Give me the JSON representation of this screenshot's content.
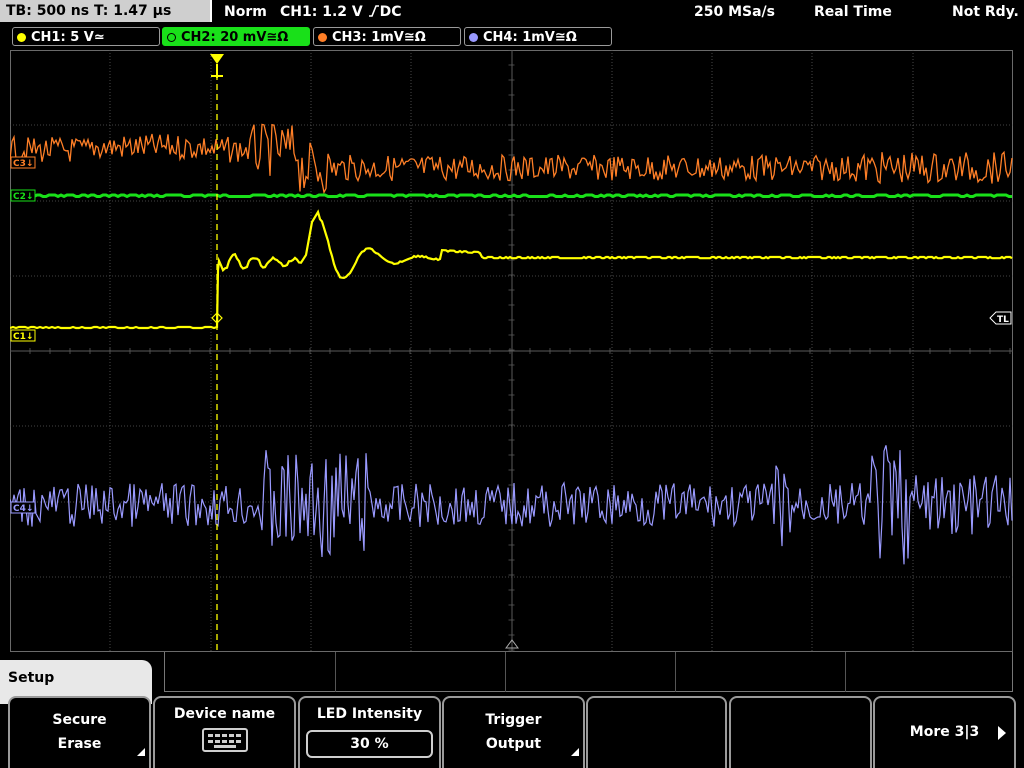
{
  "topbar": {
    "timebase": "TB: 500 ns   T: 1.47 µs",
    "trigger_mode": "Norm",
    "trigger_info": "CH1: 1.2 V",
    "trigger_suffix": "DC",
    "sample_rate": "250 MSa/s",
    "acq_mode": "Real Time",
    "status": "Not Rdy."
  },
  "channels": [
    {
      "label": "CH1: 5 V≃",
      "color": "#ffff00",
      "active": false
    },
    {
      "label": "CH2: 20 mV≅Ω",
      "color": "#19e019",
      "active": true
    },
    {
      "label": "CH3: 1mV≅Ω",
      "color": "#ff7f27",
      "active": false
    },
    {
      "label": "CH4: 1mV≅Ω",
      "color": "#9a9aff",
      "active": false
    }
  ],
  "markers": {
    "ch3": "C3↓",
    "ch2": "C2↓",
    "ch1": "C1↓",
    "ch4": "C4↓",
    "trigger_level": "TL"
  },
  "menu": {
    "title": "Setup",
    "softkeys": [
      {
        "line1": "Secure",
        "line2": "Erase"
      },
      {
        "line1": "Device name",
        "line2": ""
      },
      {
        "line1": "LED Intensity",
        "value": "30 %"
      },
      {
        "line1": "Trigger",
        "line2": "Output"
      },
      {
        "line1": "",
        "line2": ""
      },
      {
        "line1": "",
        "line2": ""
      },
      {
        "line1": "More 3|3",
        "line2": ""
      }
    ]
  },
  "colors": {
    "ch1": "#ffff00",
    "ch2": "#19e019",
    "ch3": "#ff7f27",
    "ch4": "#9a9aff",
    "grid": "#5a5a5a"
  }
}
